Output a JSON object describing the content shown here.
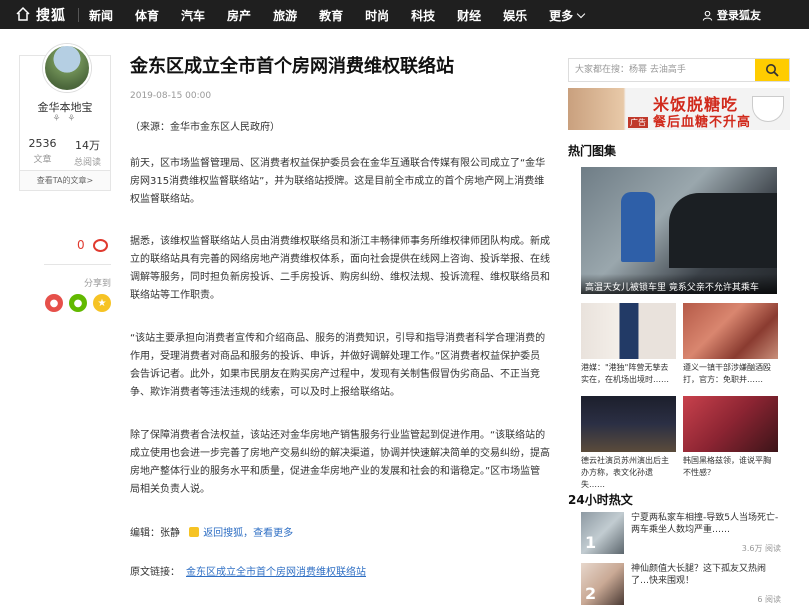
{
  "topbar": {
    "logo": "搜狐",
    "nav": [
      "新闻",
      "体育",
      "汽车",
      "房产",
      "旅游",
      "教育",
      "时尚",
      "科技",
      "财经",
      "娱乐",
      "更多"
    ],
    "login": "登录狐友"
  },
  "author": {
    "name": "金华本地宝",
    "articles_count": "2536",
    "articles_label": "文章",
    "reads_count": "14万",
    "reads_label": "总阅读",
    "view_all": "查看TA的文章>"
  },
  "comment": {
    "count": "0"
  },
  "share": {
    "label": "分享到"
  },
  "article": {
    "title": "金东区成立全市首个房网消费维权联络站",
    "date": "2019-08-15 00:00",
    "source": "（来源：金华市金东区人民政府）",
    "p1": "前天，区市场监督管理局、区消费者权益保护委员会在金华互通联合传媒有限公司成立了“金华房网315消费维权监督联络站”，并为联络站授牌。这是目前全市成立的首个房地产网上消费维权监督联络站。",
    "p2": "据悉，该维权监督联络站人员由消费维权联络员和浙江丰畅律师事务所维权律师团队构成。新成立的联络站具有完善的网络房地产消费维权体系，面向社会提供在线网上咨询、投诉举报、在线调解等服务，同时担负新房投诉、二手房投诉、购房纠纷、维权法规、投诉流程、维权联络员和联络站等工作职责。",
    "p3": "“该站主要承担向消费者宣传和介绍商品、服务的消费知识，引导和指导消费者科学合理消费的作用，受理消费者对商品和服务的投诉、申诉，并做好调解处理工作。”区消费者权益保护委员会告诉记者。此外，如果市民朋友在购买房产过程中，发现有关制售假冒伪劣商品、不正当竞争、欺诈消费者等违法违规的线索，可以及时上报给联络站。",
    "p4": "除了保障消费者合法权益，该站还对金华房地产销售服务行业监管起到促进作用。“该联络站的成立使用也会进一步完善了房地产交易纠纷的解决渠道，协调并快速解决简单的交易纠纷，提高房地产整体行业的服务水平和质量，促进金华房地产业的发展和社会的和谐稳定。”区市场监管局相关负责人说。",
    "editor_label": "编辑：",
    "editor_name": "张静",
    "back_link": "返回搜狐，查看更多",
    "origin_label": "原文链接：",
    "origin_link": "金东区成立全市首个房网消费维权联络站"
  },
  "sidebar": {
    "search_placeholder": "大家都在搜：杨幂 去油高手",
    "ad_line1": "米饭脱糖吃",
    "ad_line2": "餐后血糖不升高",
    "ad_tag": "广告",
    "hot_images_title": "热门图集",
    "hot_big_caption": "高温天女儿被锁车里 竟系父亲不允许其乘车",
    "grid": [
      {
        "caption": "港媒：\"港独\"阵营无孳去实在，在机场出境时……"
      },
      {
        "caption": "遵义一镇干部涉嫌酗酒殴打，官方：免职并……"
      },
      {
        "caption": "德云社演员苏州演出后主办方称，表文化孙遗失……"
      },
      {
        "caption": "韩国黑格兹领，谁说平胸不性感？"
      }
    ],
    "hot24_title": "24小时热文",
    "hot24": [
      {
        "num": "1",
        "title": "宁夏两私家车相撞-导致5人当场死亡-两车乘坐人数均严重……",
        "reads": "3.6万 阅读"
      },
      {
        "num": "2",
        "title": "神仙颜值大长腿？这下孤友又热闹了…快来围观！",
        "reads": "6 阅读"
      }
    ]
  }
}
